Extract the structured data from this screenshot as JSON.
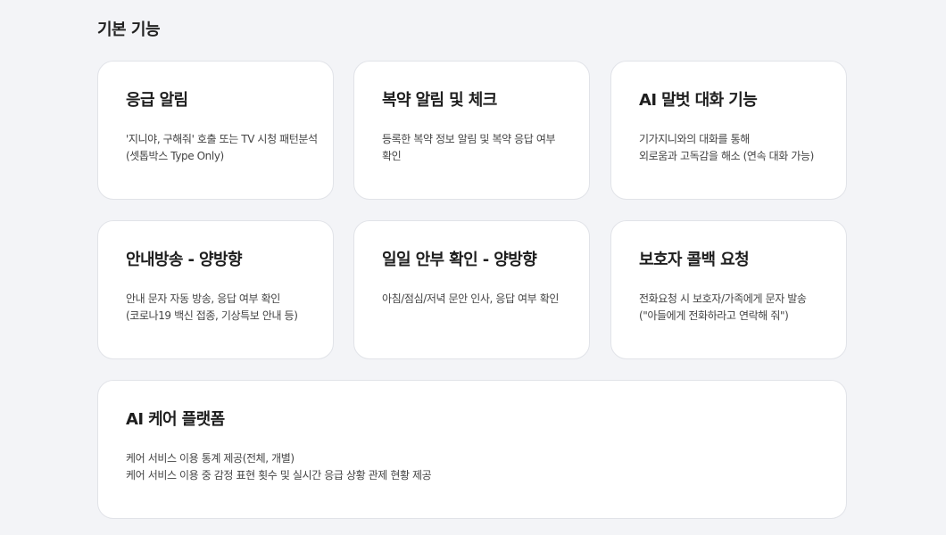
{
  "section": {
    "title": "기본 기능"
  },
  "cards": [
    {
      "title": "응급 알림",
      "lines": [
        "'지니야, 구해줘' 호출 또는 TV 시청 패턴분석",
        "(셋톱박스 Type Only)"
      ]
    },
    {
      "title": "복약 알림 및 체크",
      "lines": [
        "등록한 복약 정보 알림 및 복약 응답 여부",
        "확인"
      ]
    },
    {
      "title": "AI 말벗 대화 기능",
      "lines": [
        "기가지니와의 대화를 통해",
        "외로움과 고독감을 해소 (연속 대화 가능)"
      ]
    },
    {
      "title": "안내방송 - 양방향",
      "lines": [
        "안내 문자 자동 방송, 응답 여부 확인",
        "(코로나19 백신 접종, 기상특보 안내 등)"
      ]
    },
    {
      "title": "일일 안부 확인 - 양방향",
      "lines": [
        "아침/점심/저녁 문안 인사, 응답 여부 확인"
      ]
    },
    {
      "title": "보호자 콜백 요청",
      "lines": [
        "전화요청 시 보호자/가족에게 문자 발송",
        "(\"아들에게 전화하라고 연락해 줘\")"
      ]
    }
  ],
  "wide_card": {
    "title": "AI 케어 플랫폼",
    "lines": [
      "케어 서비스 이용 통계 제공(전체, 개별)",
      "케어 서비스 이용 중 감정 표현 횟수 및 실시간 응급 상황 관제 현황 제공"
    ]
  }
}
